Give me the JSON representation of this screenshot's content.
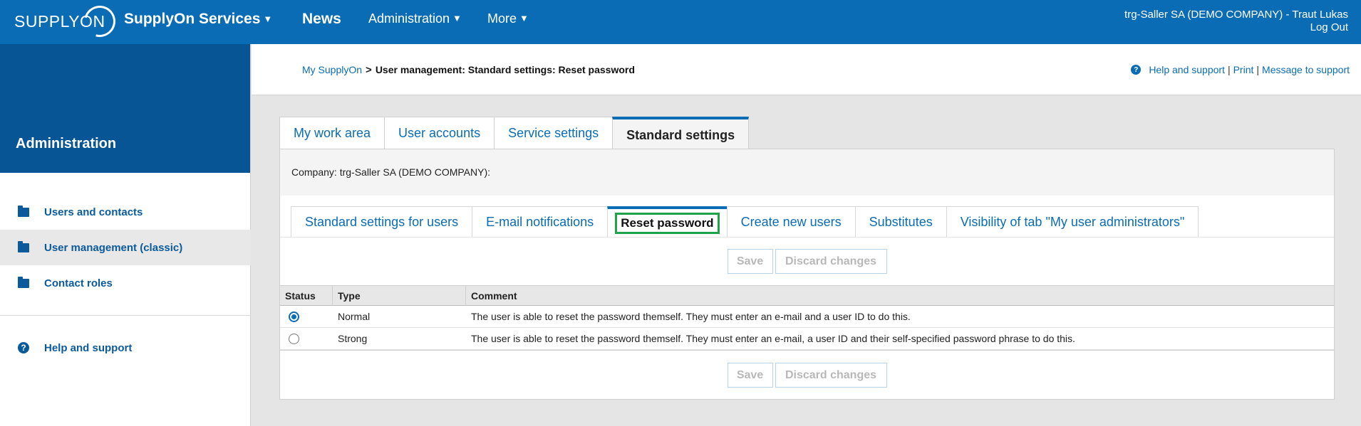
{
  "header": {
    "logo_text": "SUPPLYON",
    "nav": [
      {
        "label": "SupplyOn Services",
        "caret": "▼"
      },
      {
        "label": "News",
        "caret": ""
      },
      {
        "label": "Administration",
        "caret": "▼"
      },
      {
        "label": "More",
        "caret": "▼"
      }
    ],
    "user_line": "trg-Saller SA (DEMO COMPANY) - Traut Lukas",
    "logout": "Log Out"
  },
  "sidebar": {
    "title": "Administration",
    "items": [
      {
        "label": "Users and contacts",
        "icon": "folder-icon"
      },
      {
        "label": "User management (classic)",
        "icon": "folder-icon"
      },
      {
        "label": "Contact roles",
        "icon": "folder-icon"
      }
    ],
    "help": {
      "label": "Help and support",
      "icon": "help-icon",
      "glyph": "?"
    }
  },
  "breadcrumb": {
    "home": "My SupplyOn",
    "separator": ">",
    "current": "User management: Standard settings: Reset password"
  },
  "toplinks": {
    "help_glyph": "?",
    "help": "Help and support",
    "print": "Print",
    "message": "Message to support",
    "pipe": "|"
  },
  "main_tabs": [
    "My work area",
    "User accounts",
    "Service settings",
    "Standard settings"
  ],
  "company_label": "Company: trg-Saller SA (DEMO COMPANY):",
  "sub_tabs": [
    "Standard settings for users",
    "E-mail notifications",
    "Reset password",
    "Create new users",
    "Substitutes",
    "Visibility of tab \"My user administrators\""
  ],
  "buttons": {
    "save": "Save",
    "discard": "Discard changes"
  },
  "table": {
    "headers": [
      "Status",
      "Type",
      "Comment"
    ],
    "rows": [
      {
        "type": "Normal",
        "comment": "The user is able to reset the password themself. They must enter an e-mail and a user ID to do this.",
        "selected": true
      },
      {
        "type": "Strong",
        "comment": "The user is able to reset the password themself. They must enter an e-mail, a user ID and their self-specified password phrase to do this.",
        "selected": false
      }
    ]
  },
  "colors": {
    "brand_blue": "#0a6cb5",
    "sidebar_blue": "#075595",
    "highlight_green": "#1fa34a"
  }
}
